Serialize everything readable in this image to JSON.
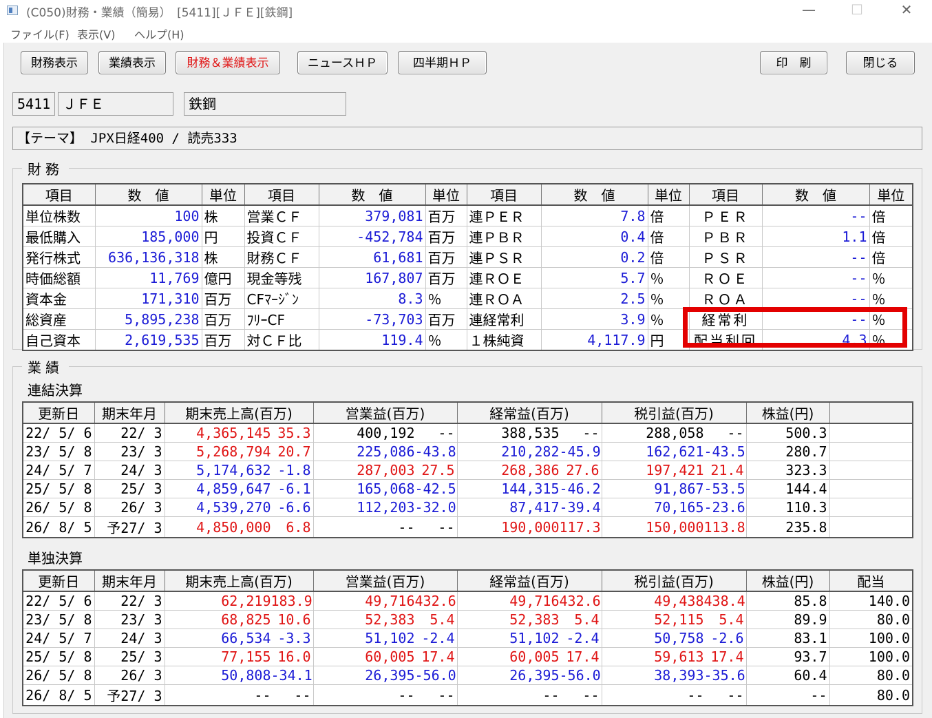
{
  "window": {
    "title": "(C050)財務・業績（簡易）　[5411][ＪＦＥ][鉄鋼]",
    "min": "—",
    "max": "☐",
    "close": "✕"
  },
  "menu": [
    "ファイル(F)",
    "表示(V)",
    "ヘルプ(H)"
  ],
  "toolbar": {
    "finance": "財務表示",
    "results": "業績表示",
    "both": "財務＆業績表示",
    "news": "ニュースＨＰ",
    "quarter": "四半期ＨＰ",
    "print": "印　刷",
    "close": "閉じる"
  },
  "stock": {
    "code": "5411",
    "name": "ＪＦＥ",
    "industry": "鉄鋼",
    "theme": "【テーマ】 JPX日経400 / 読売333"
  },
  "finance": {
    "label": "財務",
    "headers": [
      "項目",
      "数　値",
      "単位",
      "項目",
      "数　値",
      "単位",
      "項目",
      "数　値",
      "単位",
      "項目",
      "数　値",
      "単位"
    ],
    "rows": [
      [
        "単位株数",
        "100",
        "株",
        "営業ＣＦ",
        "379,081",
        "百万",
        "連ＰＥＲ",
        "7.8",
        "倍",
        "ＰＥＲ",
        "--",
        "倍"
      ],
      [
        "最低購入",
        "185,000",
        "円",
        "投資ＣＦ",
        "-452,784",
        "百万",
        "連ＰＢＲ",
        "0.4",
        "倍",
        "ＰＢＲ",
        "1.1",
        "倍"
      ],
      [
        "発行株式",
        "636,136,318",
        "株",
        "財務ＣＦ",
        "61,681",
        "百万",
        "連ＰＳＲ",
        "0.2",
        "倍",
        "ＰＳＲ",
        "--",
        "倍"
      ],
      [
        "時価総額",
        "11,769",
        "億円",
        "現金等残",
        "167,807",
        "百万",
        "連ＲＯＥ",
        "5.7",
        "％",
        "ＲＯＥ",
        "--",
        "％"
      ],
      [
        "資本金",
        "171,310",
        "百万",
        "CFﾏｰｼﾞﾝ",
        "8.3",
        "％",
        "連ＲＯＡ",
        "2.5",
        "％",
        "ＲＯＡ",
        "--",
        "％"
      ],
      [
        "総資産",
        "5,895,238",
        "百万",
        "ﾌﾘｰCF",
        "-73,703",
        "百万",
        "連経常利",
        "3.9",
        "％",
        "経常利",
        "--",
        "％"
      ],
      [
        "自己資本",
        "2,619,535",
        "百万",
        "対ＣＦ比",
        "119.4",
        "％",
        "１株純資",
        "4,117.9",
        "円",
        "配当利回",
        "4.3",
        "％"
      ]
    ]
  },
  "results": {
    "label": "業績",
    "consolidated_label": "連結決算",
    "consolidated_headers": [
      "更新日",
      "期末年月",
      "期末売上高(百万)",
      "営業益(百万)",
      "経常益(百万)",
      "税引益(百万)",
      "株益(円)",
      ""
    ],
    "consolidated_rows": [
      [
        "22/ 5/ 6",
        "22/ 3",
        "4,365,145",
        "35.3",
        "400,192",
        "--",
        "388,535",
        "--",
        "288,058",
        "--",
        "500.3",
        ""
      ],
      [
        "23/ 5/ 8",
        "23/ 3",
        "5,268,794",
        "20.7",
        "225,086",
        "-43.8",
        "210,282",
        "-45.9",
        "162,621",
        "-43.5",
        "280.7",
        ""
      ],
      [
        "24/ 5/ 7",
        "24/ 3",
        "5,174,632",
        "-1.8",
        "287,003",
        "27.5",
        "268,386",
        "27.6",
        "197,421",
        "21.4",
        "323.3",
        ""
      ],
      [
        "25/ 5/ 8",
        "25/ 3",
        "4,859,647",
        "-6.1",
        "165,068",
        "-42.5",
        "144,315",
        "-46.2",
        "91,867",
        "-53.5",
        "144.4",
        ""
      ],
      [
        "26/ 5/ 8",
        "26/ 3",
        "4,539,270",
        "-6.6",
        "112,203",
        "-32.0",
        "87,417",
        "-39.4",
        "70,165",
        "-23.6",
        "110.3",
        ""
      ],
      [
        "26/ 8/ 5",
        "予27/ 3",
        "4,850,000",
        "6.8",
        "--",
        "--",
        "190,000",
        "117.3",
        "150,000",
        "113.8",
        "235.8",
        ""
      ]
    ],
    "standalone_label": "単独決算",
    "standalone_headers": [
      "更新日",
      "期末年月",
      "期末売上高(百万)",
      "営業益(百万)",
      "経常益(百万)",
      "税引益(百万)",
      "株益(円)",
      "配当"
    ],
    "standalone_rows": [
      [
        "22/ 5/ 6",
        "22/ 3",
        "62,219",
        "183.9",
        "49,716",
        "432.6",
        "49,716",
        "432.6",
        "49,438",
        "438.4",
        "85.8",
        "140.0"
      ],
      [
        "23/ 5/ 8",
        "23/ 3",
        "68,825",
        "10.6",
        "52,383",
        "5.4",
        "52,383",
        "5.4",
        "52,115",
        "5.4",
        "89.9",
        "80.0"
      ],
      [
        "24/ 5/ 7",
        "24/ 3",
        "66,534",
        "-3.3",
        "51,102",
        "-2.4",
        "51,102",
        "-2.4",
        "50,758",
        "-2.6",
        "83.1",
        "100.0"
      ],
      [
        "25/ 5/ 8",
        "25/ 3",
        "77,155",
        "16.0",
        "60,005",
        "17.4",
        "60,005",
        "17.4",
        "59,613",
        "17.4",
        "93.7",
        "100.0"
      ],
      [
        "26/ 5/ 8",
        "26/ 3",
        "50,808",
        "-34.1",
        "26,395",
        "-56.0",
        "26,395",
        "-56.0",
        "38,393",
        "-35.6",
        "60.4",
        "80.0"
      ],
      [
        "26/ 8/ 5",
        "予27/ 3",
        "--",
        "--",
        "--",
        "--",
        "--",
        "--",
        "--",
        "--",
        "--",
        "80.0"
      ]
    ]
  },
  "colors": {
    "up": "#e01515",
    "down": "#1b1bd6",
    "neutral": "#000000",
    "highlight": "#e30000"
  }
}
